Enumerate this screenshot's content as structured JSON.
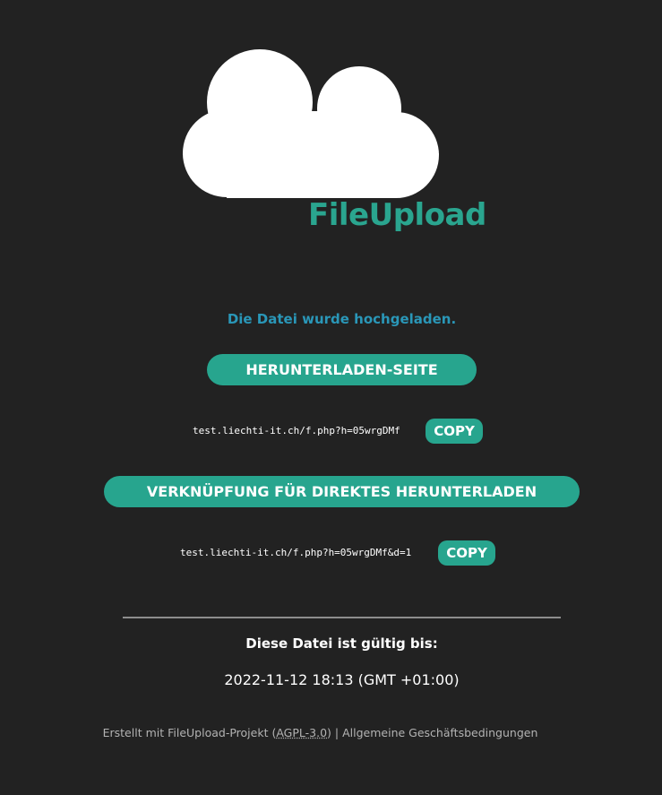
{
  "brand": {
    "title": "FileUpload"
  },
  "status_message": "Die Datei wurde hochgeladen.",
  "download_page": {
    "button_label": "HERUNTERLADEN-SEITE",
    "link": "test.liechti-it.ch/f.php?h=05wrgDMf",
    "copy_label": "COPY"
  },
  "direct_download": {
    "button_label": "VERKNÜPFUNG FÜR DIREKTES HERUNTERLADEN",
    "link": "test.liechti-it.ch/f.php?h=05wrgDMf&d=1",
    "copy_label": "COPY"
  },
  "validity": {
    "label": "Diese Datei ist gültig bis:",
    "date": "2022-11-12 18:13 (GMT +01:00)"
  },
  "footer": {
    "prefix": "Erstellt mit ",
    "project_link": "FileUpload-Projekt",
    "paren_open": " (",
    "license": "AGPL-3.0",
    "paren_close": ")",
    "separator": " | ",
    "terms_link": "Allgemeine Geschäftsbedingungen"
  },
  "colors": {
    "background": "#222222",
    "accent": "#27a58e",
    "status": "#2a97b8",
    "divider": "#8d8d8d"
  },
  "icons": {
    "logo": "cloud-icon"
  }
}
